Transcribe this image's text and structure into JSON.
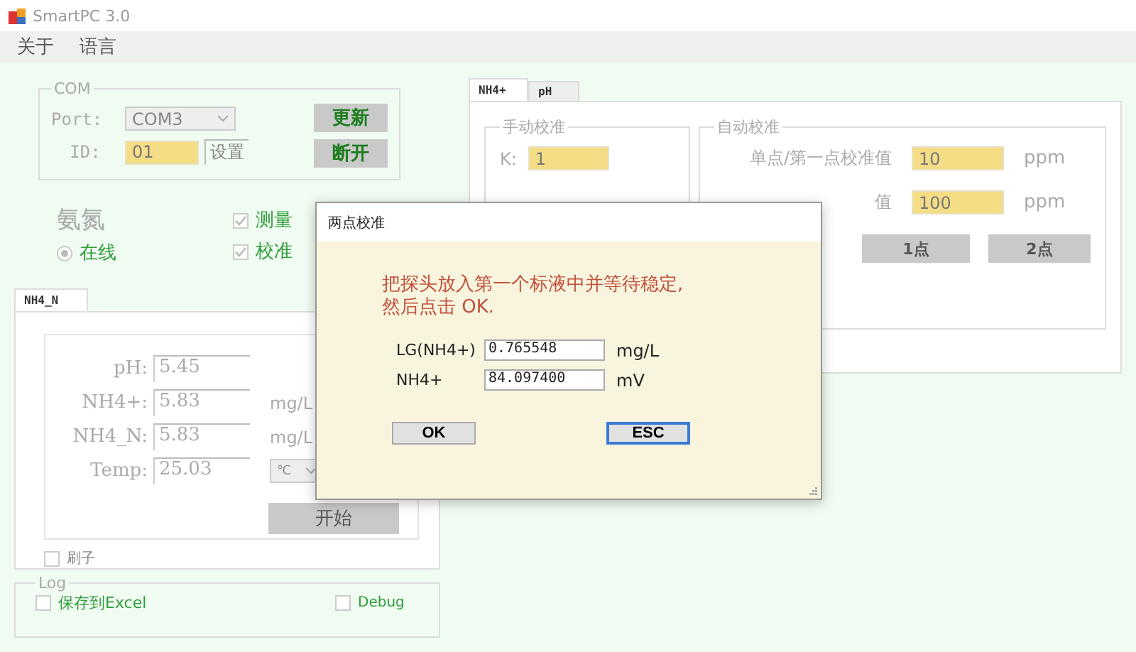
{
  "window": {
    "title": "SmartPC 3.0"
  },
  "menu": [
    {
      "label": "关于"
    },
    {
      "label": "语言"
    }
  ],
  "com": {
    "title": "COM",
    "port_label": "Port:",
    "port": "COM3",
    "id_label": "ID:",
    "id": "01",
    "set_label": "设置",
    "buttons": [
      "更新",
      "断开"
    ]
  },
  "sensor": {
    "name": "氨氮",
    "mode": {
      "label": "在线",
      "selected": true
    },
    "options": [
      {
        "label": "测量",
        "checked": true
      },
      {
        "label": "校准",
        "checked": true
      }
    ]
  },
  "left_tabs": [
    {
      "label": "NH4_N",
      "selected": true
    }
  ],
  "readings": [
    {
      "label": "pH:",
      "value": "5.45"
    },
    {
      "label": "NH4+:",
      "value": "5.83",
      "unit": "mg/L"
    },
    {
      "label": "NH4_N:",
      "value": "5.83",
      "unit": "mg/L"
    },
    {
      "label": "Temp:",
      "value": "25.03",
      "unit": "℃",
      "kind": "select"
    }
  ],
  "start_button": "开始",
  "brush": {
    "label": "刷子",
    "checked": false
  },
  "log": {
    "title": "Log",
    "options": [
      {
        "label": "保存到Excel",
        "checked": false
      },
      {
        "label": "Debug",
        "checked": false
      }
    ]
  },
  "right_tabs": [
    {
      "label": "NH4+",
      "selected": true
    },
    {
      "label": "pH",
      "selected": false
    }
  ],
  "manual": {
    "title": "手动校准",
    "fields": [
      {
        "label": "K:",
        "value": "1"
      }
    ]
  },
  "auto": {
    "title": "自动校准",
    "fields": [
      {
        "label": "单点/第一点校准值",
        "value": "10",
        "unit": "ppm"
      },
      {
        "label": "值",
        "value": "100",
        "unit": "ppm"
      }
    ],
    "buttons": [
      "1点",
      "2点"
    ]
  },
  "dialog": {
    "title": "两点校准",
    "message": "把探头放入第一个标液中并等待稳定,\n然后点击 OK.",
    "fields": [
      {
        "label": "LG(NH4+)",
        "value": "0.765548",
        "unit": "mg/L"
      },
      {
        "label": "NH4+",
        "value": "84.097400",
        "unit": "mV"
      }
    ],
    "buttons": [
      {
        "label": "OK",
        "focused": false
      },
      {
        "label": "ESC",
        "focused": true
      }
    ]
  }
}
